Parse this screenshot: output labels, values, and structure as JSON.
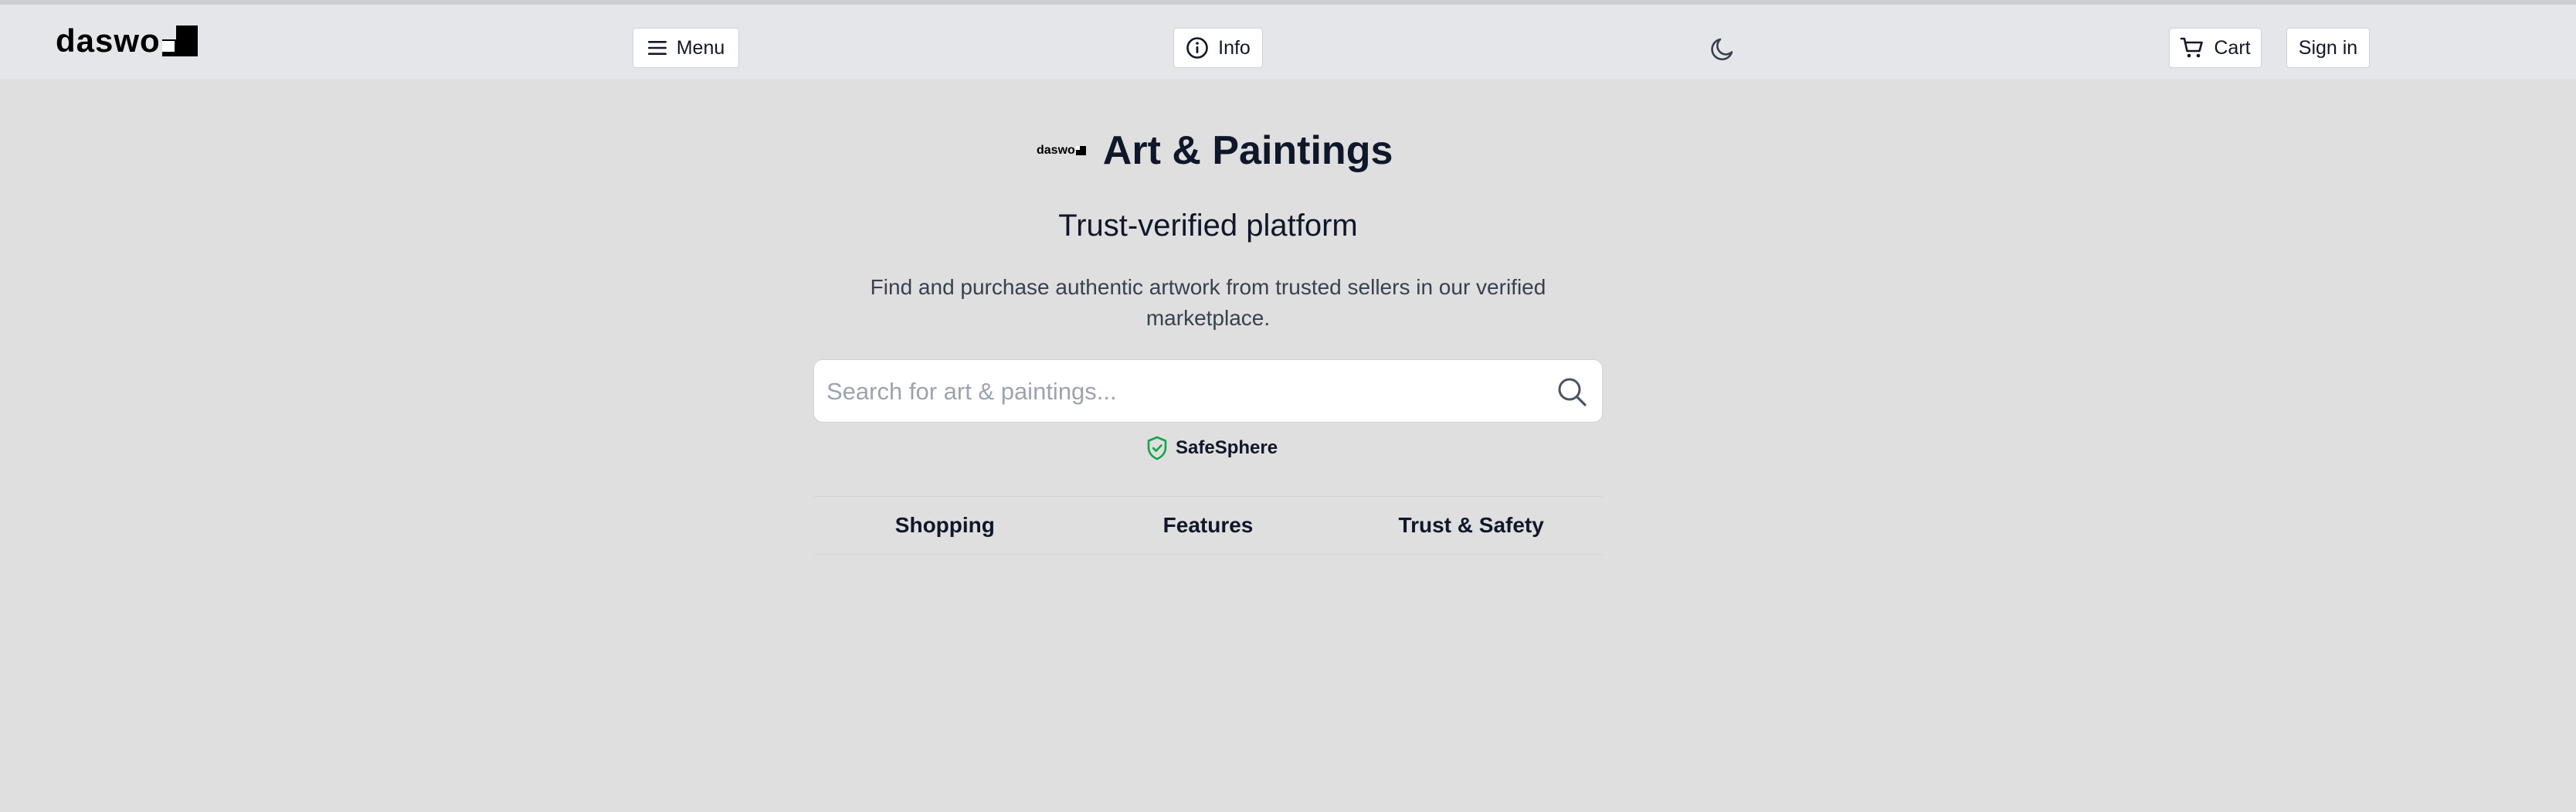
{
  "header": {
    "logo_text": "daswo",
    "menu_label": "Menu",
    "info_label": "Info",
    "cart_label": "Cart",
    "signin_label": "Sign in"
  },
  "hero": {
    "logo_small_text": "daswo",
    "title": "Art & Paintings",
    "subtitle": "Trust-verified platform",
    "description": "Find and purchase authentic artwork from trusted sellers in our verified marketplace."
  },
  "search": {
    "placeholder": "Search for art & paintings...",
    "value": ""
  },
  "badge": {
    "label": "SafeSphere",
    "icon": "shield-check-icon",
    "color": "#16a34a"
  },
  "tabs": [
    {
      "label": "Shopping"
    },
    {
      "label": "Features"
    },
    {
      "label": "Trust & Safety"
    }
  ],
  "colors": {
    "page_bg": "#dfdfdf",
    "header_bg": "#e5e6ea",
    "text": "#0f172a"
  }
}
